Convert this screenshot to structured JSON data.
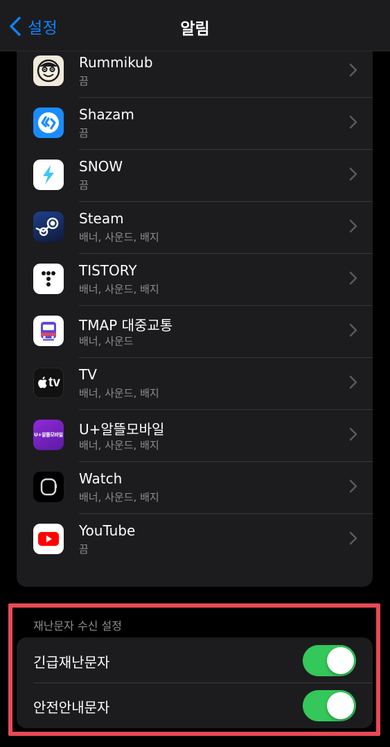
{
  "nav": {
    "back_label": "설정",
    "title": "알림"
  },
  "partial_row": {
    "sub": "끔"
  },
  "apps": [
    {
      "name": "Rummikub",
      "sub": "끔",
      "icon": "rummikub-icon"
    },
    {
      "name": "Shazam",
      "sub": "끔",
      "icon": "shazam-icon"
    },
    {
      "name": "SNOW",
      "sub": "끔",
      "icon": "snow-icon"
    },
    {
      "name": "Steam",
      "sub": "배너, 사운드, 배지",
      "icon": "steam-icon"
    },
    {
      "name": "TISTORY",
      "sub": "배너, 사운드, 배지",
      "icon": "tistory-icon"
    },
    {
      "name": "TMAP 대중교통",
      "sub": "배너, 사운드",
      "icon": "tmap-transit-icon"
    },
    {
      "name": "TV",
      "sub": "배너, 사운드, 배지",
      "icon": "apple-tv-icon"
    },
    {
      "name": "U+알뜰모바일",
      "sub": "배너, 사운드, 배지",
      "icon": "uplus-mobile-icon"
    },
    {
      "name": "Watch",
      "sub": "배너, 사운드, 배지",
      "icon": "watch-icon"
    },
    {
      "name": "YouTube",
      "sub": "끔",
      "icon": "youtube-icon"
    }
  ],
  "emergency": {
    "header": "재난문자 수신 설정",
    "toggles": [
      {
        "label": "긴급재난문자",
        "on": true
      },
      {
        "label": "안전안내문자",
        "on": true
      }
    ]
  },
  "icon_texts": {
    "uplus": "U+알뜰모바일",
    "tv": "tv"
  },
  "colors": {
    "accent": "#0a84ff",
    "toggle_on": "#34c759",
    "highlight": "#e84a55",
    "background": "#000000",
    "group_bg": "#1c1c1e"
  }
}
